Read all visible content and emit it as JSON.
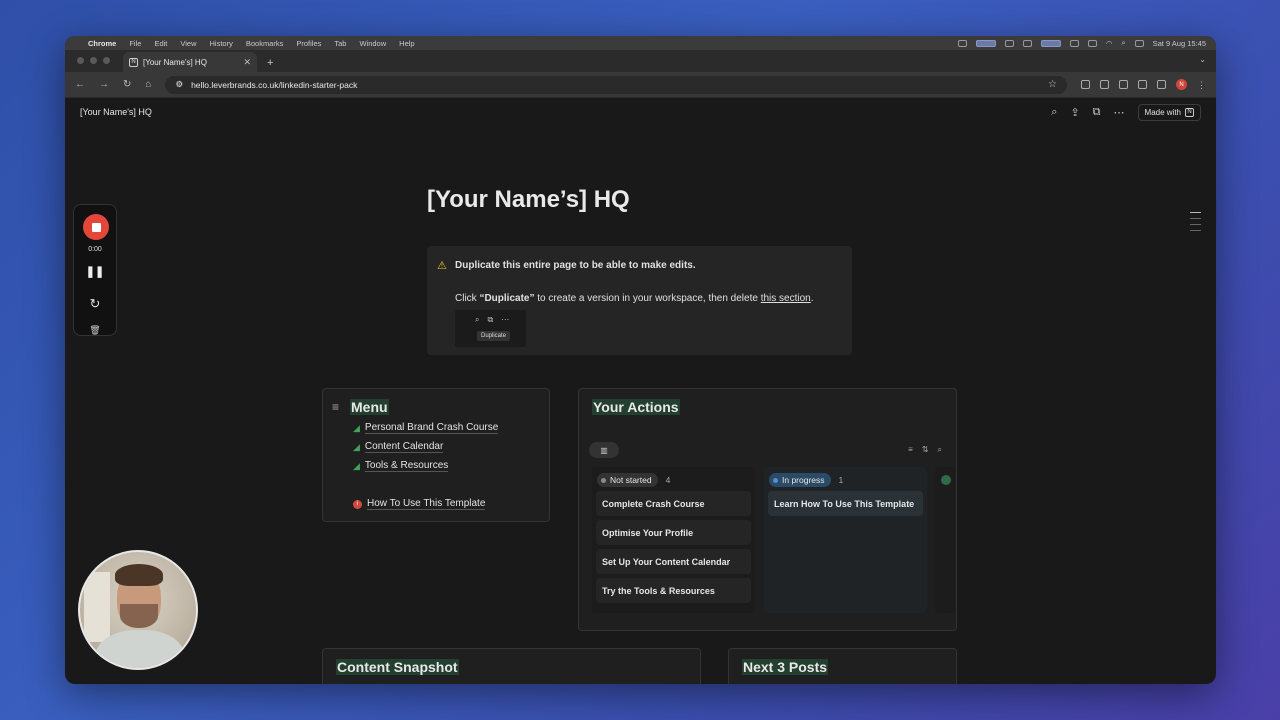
{
  "macbar": {
    "app": "Chrome",
    "menus": [
      "File",
      "Edit",
      "View",
      "History",
      "Bookmarks",
      "Profiles",
      "Tab",
      "Window",
      "Help"
    ],
    "clock": "Sat 9 Aug  15:45"
  },
  "browser": {
    "tab_title": "[Your Name's] HQ",
    "url": "hello.leverbrands.co.uk/linkedin-starter-pack",
    "avatar_letter": "N"
  },
  "notion_header": {
    "breadcrumb": "[Your Name's] HQ",
    "made_with": "Made with"
  },
  "page": {
    "title": "[Your Name’s] HQ"
  },
  "callout": {
    "heading": "Duplicate this entire page to be able to make edits.",
    "body_prefix": "Click ",
    "body_bold": "“Duplicate”",
    "body_middle": " to create a version in your workspace, then delete ",
    "body_link": "this section",
    "body_suffix": ".",
    "tooltip": "Duplicate"
  },
  "menu": {
    "title": "Menu",
    "items": [
      "Personal Brand Crash Course",
      "Content Calendar",
      "Tools & Resources"
    ],
    "help_item": "How To Use This Template"
  },
  "actions": {
    "title": "Your Actions",
    "columns": [
      {
        "status": "Not started",
        "count": "4",
        "tasks": [
          "Complete Crash Course",
          "Optimise Your Profile",
          "Set Up Your Content Calendar",
          "Try the Tools & Resources"
        ]
      },
      {
        "status": "In progress",
        "count": "1",
        "tasks": [
          "Learn How To Use This Template"
        ]
      }
    ]
  },
  "sections": {
    "snapshot": "Content Snapshot",
    "next_posts": "Next 3 Posts"
  },
  "recorder": {
    "time": "0:00"
  },
  "colors": {
    "page_bg": "#191919",
    "accent_title_bg": "#233f30",
    "stop_red": "#e4463a",
    "in_progress_blue": "#2a4a66"
  }
}
